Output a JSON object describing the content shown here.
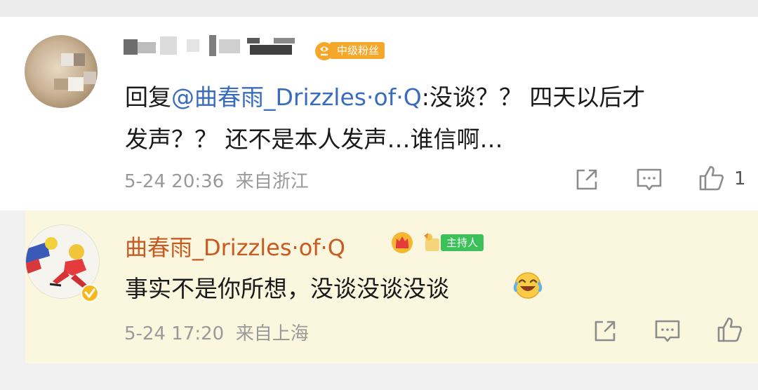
{
  "comment": {
    "badge": "中级粉丝",
    "reply_prefix": "回复",
    "mention": "@曲春雨_Drizzles·of·Q",
    "line1_rest": ":没谈？？ 四天以后才",
    "line2": "发声？？ 还不是本人发声…谁信啊…",
    "time": "5-24 20:36",
    "location": "来自浙江",
    "like_count": "1"
  },
  "reply": {
    "username": "曲春雨_Drizzles·of·Q",
    "host_badge": "主持人",
    "text": "事实不是你所想，没谈没谈没谈",
    "time": "5-24 17:20",
    "location": "来自上海"
  },
  "icons": [
    "share-icon",
    "comment-icon",
    "like-icon",
    "crown-icon",
    "laugh-emoji-icon",
    "verified-icon"
  ],
  "colors": {
    "mention": "#3a6cbe",
    "reply_username": "#c85b22",
    "fan_badge": "#f5a72a",
    "host_badge": "#3cc15a",
    "reply_background": "#fbf6de"
  }
}
